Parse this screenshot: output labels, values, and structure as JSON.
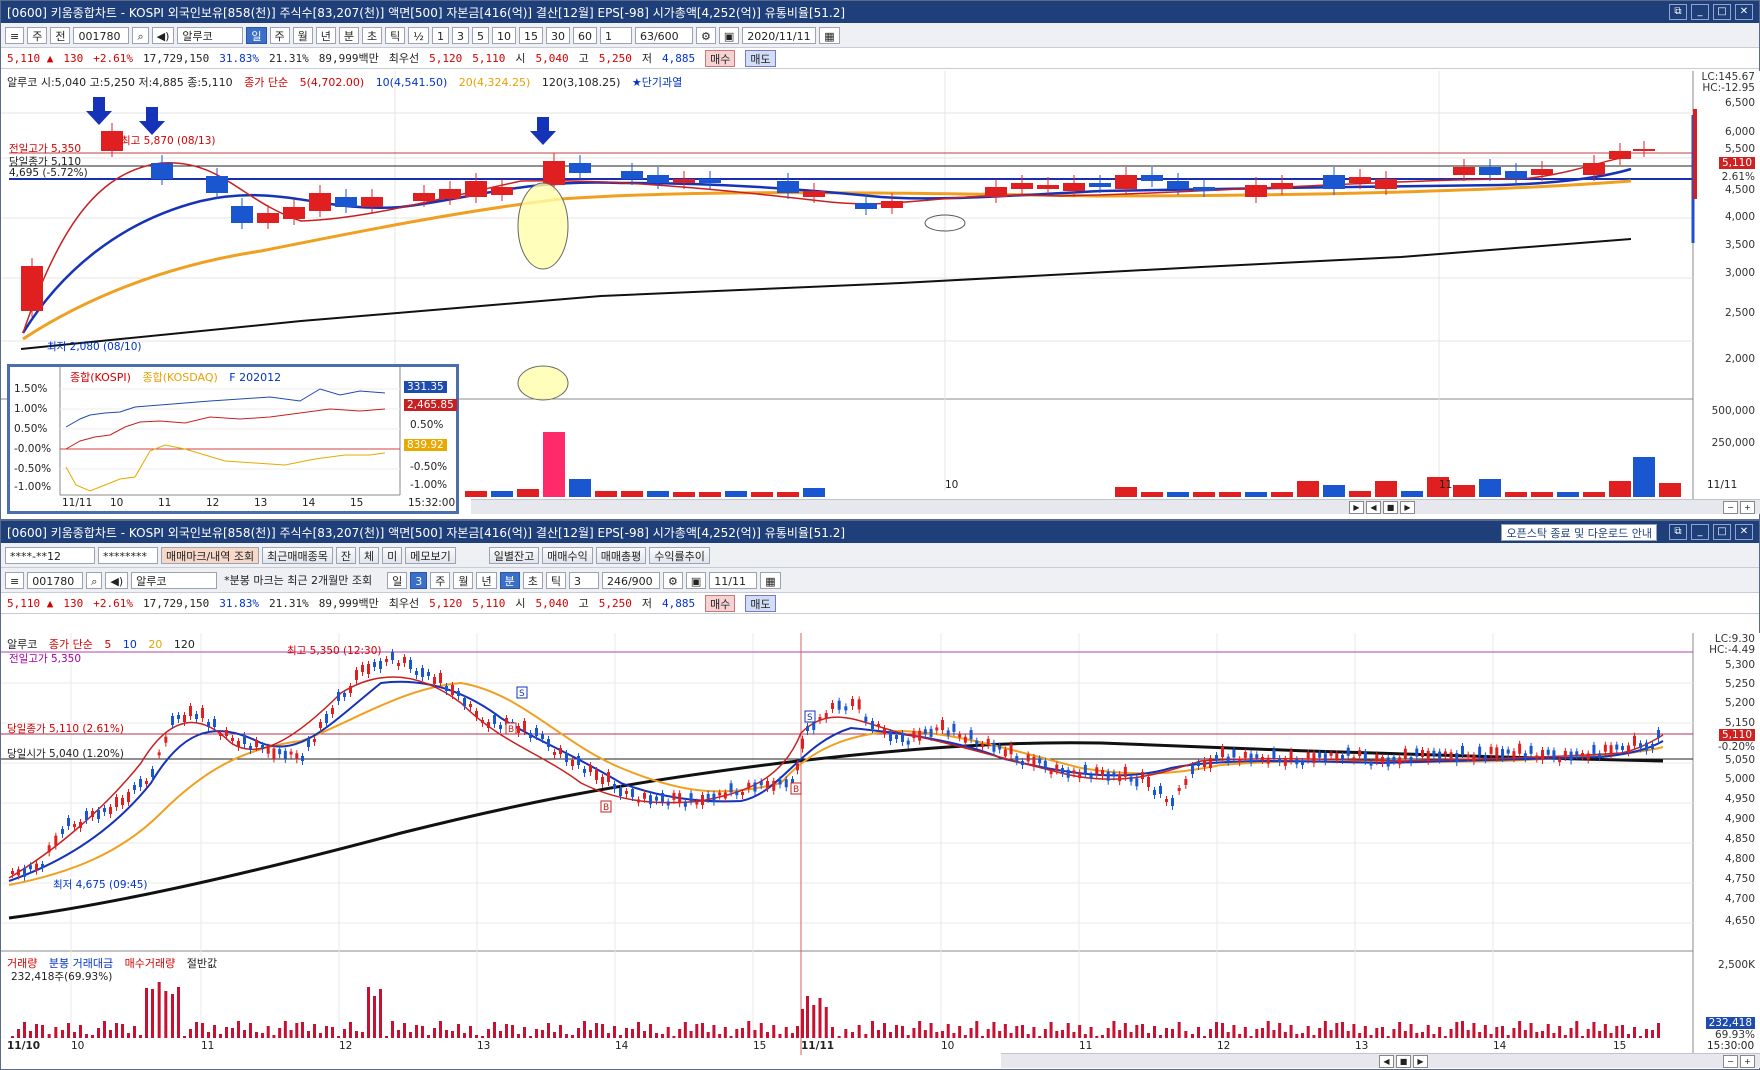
{
  "top": {
    "title": "[0600] 키움종합차트 - KOSPI 외국인보유[858(천)] 주식수[83,207(천)] 액면[500] 자본금[416(억)] 결산[12월] EPS[-98] 시가총액[4,252(억)] 유통비율[51.2]",
    "toolbar": {
      "market": "주",
      "prev": "전",
      "code": "001780",
      "name": "알루코",
      "periods": [
        "일",
        "주",
        "월",
        "년",
        "분",
        "초",
        "틱"
      ],
      "active_period": "일",
      "minutes": [
        "½",
        "1",
        "3",
        "5",
        "10",
        "15",
        "30",
        "60"
      ],
      "count_sel": "1",
      "range": "63/600",
      "date": "2020/11/11"
    },
    "quote": {
      "price": "5,110 ▲",
      "change": "130",
      "rate": "+2.61%",
      "volume": "17,729,150",
      "ratio1": "31.83%",
      "ratio2": "21.31%",
      "amount": "89,999백만",
      "best_label": "최우선",
      "ask": "5,120",
      "bid": "5,110",
      "open_l": "시",
      "open": "5,040",
      "high_l": "고",
      "high": "5,250",
      "low_l": "저",
      "low": "4,885",
      "buy": "매수",
      "sell": "매도"
    },
    "legend": {
      "ohlc": "알루코 시:5,040 고:5,250 저:4,885 종:5,110",
      "ma_title": "종가 단순",
      "ma5": "5(4,702.00)",
      "ma10": "10(4,541.50)",
      "ma20": "20(4,324.25)",
      "ma120": "120(3,108.25)",
      "signal": "★단기과열"
    },
    "annotations": {
      "prev_high": "전일고가 5,350",
      "prev_close": "당일종가 5,110",
      "level": "4,695 (-5.72%)",
      "max": "최고 5,870 (08/13)",
      "min": "최저 2,080 (08/10)"
    },
    "right_axis": {
      "lc": "LC:145.67",
      "hc": "HC:-12.95",
      "ticks": [
        "6,500",
        "6,000",
        "5,500",
        "5,110",
        "2.61%",
        "4,500",
        "4,000",
        "3,500",
        "3,000",
        "2,500",
        "2,000"
      ],
      "vol_ticks": [
        "500,000",
        "250,000"
      ]
    },
    "dates": [
      "10",
      "11",
      "11/11"
    ]
  },
  "inset": {
    "legend": [
      "종합(KOSPI)",
      "종합(KOSDAQ)",
      "F 202012"
    ],
    "left_ticks": [
      "1.50%",
      "1.00%",
      "0.50%",
      "-0.00%",
      "-0.50%",
      "-1.00%"
    ],
    "right_ticks": [
      "0.50%",
      "-0.50%",
      "-1.00%"
    ],
    "values": [
      "331.35",
      "2,465.85",
      "839.92"
    ],
    "x": [
      "11/11",
      "10",
      "11",
      "12",
      "13",
      "14",
      "15"
    ],
    "time": "15:32:00"
  },
  "bottom": {
    "title": "[0600] 키움종합차트 - KOSPI 외국인보유[858(천)] 주식수[83,207(천)] 액면[500] 자본금[416(억)] 결산[12월] EPS[-98] 시가총액[4,252(억)] 유통비율[51.2]",
    "notice": "오픈스탁 종료 및 다운로드 안내",
    "account": "****-**12",
    "password": "********",
    "tabs": [
      "매매마크/내역 조회",
      "최근매매종목",
      "잔",
      "체",
      "미",
      "메모보기",
      "일별잔고",
      "매매수익",
      "매매총평",
      "수익률추이"
    ],
    "code": "001780",
    "name": "알루코",
    "note": "*분봉 마크는 최근 2개월만 조회",
    "periods": [
      "일",
      "3",
      "주",
      "월",
      "년",
      "분",
      "초",
      "틱"
    ],
    "count_sel": "3",
    "range": "246/900",
    "date": "11/11",
    "legend": {
      "name": "알루코",
      "ma_title": "종가 단순",
      "ma5": "5",
      "ma10": "10",
      "ma20": "20",
      "ma120": "120"
    },
    "annotations": {
      "prev_high": "전일고가 5,350",
      "max": "최고 5,350 (12:30)",
      "close": "당일종가 5,110 (2.61%)",
      "open": "당일시가 5,040 (1.20%)",
      "min": "최저 4,675 (09:45)"
    },
    "right_axis": {
      "lc": "LC:9.30",
      "hc": "HC:-4.49",
      "ticks": [
        "5,300",
        "5,250",
        "5,200",
        "5,150",
        "5,110",
        "-0.20%",
        "5,050",
        "5,000",
        "4,950",
        "4,900",
        "4,850",
        "4,800",
        "4,750",
        "4,700",
        "4,650"
      ],
      "vol_ticks": [
        "2,500K",
        "232,418",
        "69.93%"
      ]
    },
    "vol_legend": [
      "거래량",
      "분봉 거래대금",
      "매수거래량",
      "절반값"
    ],
    "vol_value": "232,418주(69.93%)",
    "dates": [
      "11/10",
      "10",
      "11",
      "12",
      "13",
      "14",
      "15",
      "11/11",
      "10",
      "11",
      "12",
      "13",
      "14",
      "15"
    ],
    "time": "15:30:00"
  }
}
